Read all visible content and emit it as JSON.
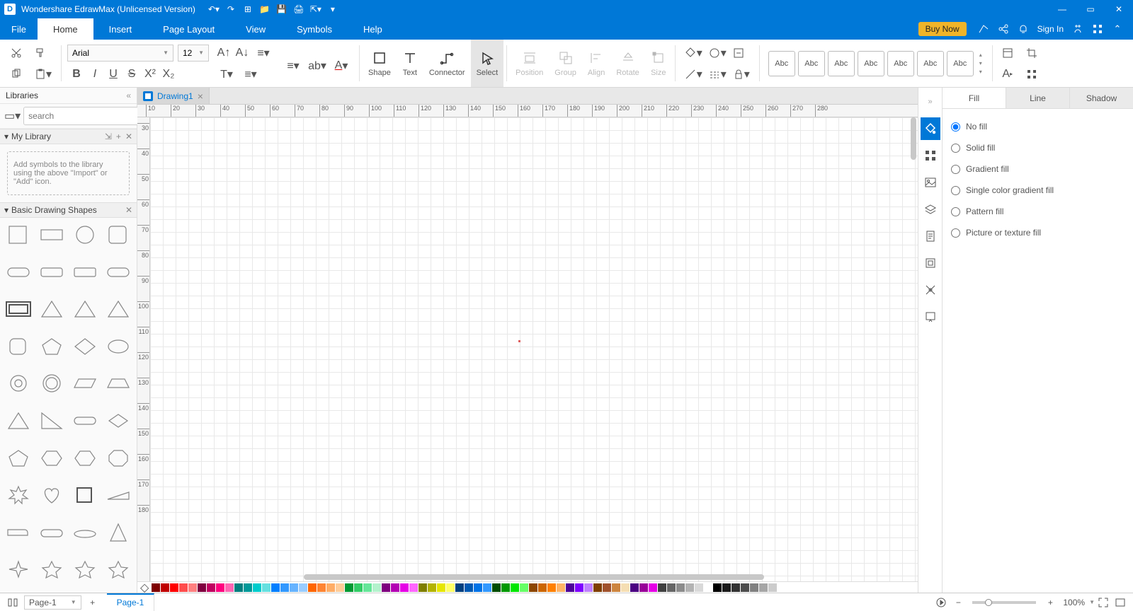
{
  "title": "Wondershare EdrawMax (Unlicensed Version)",
  "menu": {
    "file": "File",
    "home": "Home",
    "insert": "Insert",
    "page_layout": "Page Layout",
    "view": "View",
    "symbols": "Symbols",
    "help": "Help"
  },
  "menu_right": {
    "buy_now": "Buy Now",
    "sign_in": "Sign In"
  },
  "ribbon": {
    "font": "Arial",
    "size": "12",
    "shape": "Shape",
    "text": "Text",
    "connector": "Connector",
    "select": "Select",
    "position": "Position",
    "group": "Group",
    "align": "Align",
    "rotate": "Rotate",
    "size_lbl": "Size",
    "abc": "Abc"
  },
  "sidebar": {
    "title": "Libraries",
    "search_placeholder": "search",
    "my_library": "My Library",
    "library_note": "Add symbols to the library using the above \"Import\" or \"Add\" icon.",
    "basic_shapes": "Basic Drawing Shapes"
  },
  "doc": {
    "tab": "Drawing1"
  },
  "ruler": {
    "h_ticks": [
      "10",
      "20",
      "30",
      "40",
      "50",
      "60",
      "70",
      "80",
      "90",
      "100",
      "110",
      "120",
      "130",
      "140",
      "150",
      "160",
      "170",
      "180",
      "190",
      "200",
      "210",
      "220",
      "230",
      "240",
      "250",
      "260",
      "270",
      "280"
    ],
    "v_ticks": [
      "30",
      "40",
      "50",
      "60",
      "70",
      "80",
      "90",
      "100",
      "110",
      "120",
      "130",
      "140",
      "150",
      "160",
      "170",
      "180"
    ]
  },
  "right_rail_expand": "»",
  "prop": {
    "tabs": {
      "fill": "Fill",
      "line": "Line",
      "shadow": "Shadow"
    },
    "options": {
      "no_fill": "No fill",
      "solid": "Solid fill",
      "gradient": "Gradient fill",
      "single_grad": "Single color gradient fill",
      "pattern": "Pattern fill",
      "picture": "Picture or texture fill"
    }
  },
  "status": {
    "page_sel": "Page-1",
    "page_tab": "Page-1",
    "zoom": "100%"
  },
  "colors": [
    "#7f0000",
    "#c00000",
    "#ff0000",
    "#ff4d4d",
    "#ff8080",
    "#800040",
    "#c00060",
    "#ff007f",
    "#ff66b3",
    "#007f7f",
    "#009999",
    "#00cccc",
    "#66e0e0",
    "#007fff",
    "#3399ff",
    "#66b3ff",
    "#99ccff",
    "#ff6600",
    "#ff8533",
    "#ffad66",
    "#ffcc99",
    "#009933",
    "#33cc66",
    "#66e699",
    "#b3f2cc",
    "#7f007f",
    "#b300b3",
    "#e600e6",
    "#ff66ff",
    "#7f7f00",
    "#b3b300",
    "#e6e600",
    "#ffff66",
    "#003f7f",
    "#0059b3",
    "#0073e6",
    "#3399ff",
    "#004d00",
    "#009900",
    "#00e600",
    "#66ff66",
    "#8c4600",
    "#cc6600",
    "#ff8000",
    "#ffb366",
    "#4d0099",
    "#7f00ff",
    "#bf80ff",
    "#7f3f00",
    "#a0522d",
    "#cd853f",
    "#f5deb3",
    "#4b0082",
    "#990099",
    "#e600e6",
    "#404040",
    "#666666",
    "#8c8c8c",
    "#b3b3b3",
    "#d9d9d9",
    "#ffffff",
    "#000000",
    "#1a1a1a",
    "#333333",
    "#4d4d4d",
    "#808080",
    "#a6a6a6",
    "#cccccc"
  ]
}
